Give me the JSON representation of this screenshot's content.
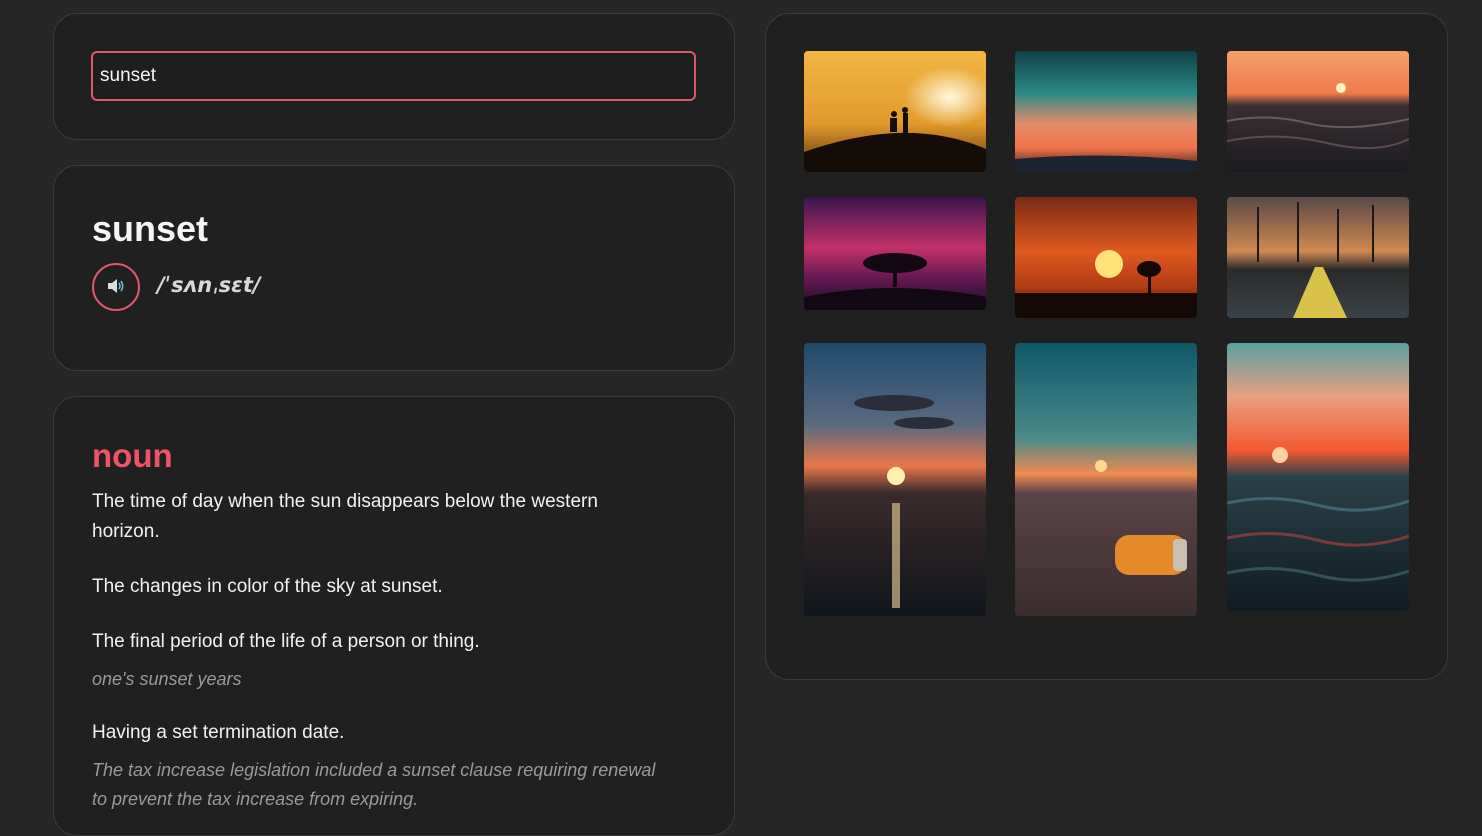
{
  "search": {
    "value": "sunset"
  },
  "entry": {
    "word": "sunset",
    "phonetic": "/ˈsʌnˌsɛt/",
    "audio_icon": "speaker-icon"
  },
  "meaning": {
    "part_of_speech": "noun",
    "definitions": [
      {
        "text": "The time of day when the sun disappears below the western horizon.",
        "example": ""
      },
      {
        "text": "The changes in color of the sky at sunset.",
        "example": ""
      },
      {
        "text": "The final period of the life of a person or thing.",
        "example": "one's sunset years"
      },
      {
        "text": "Having a set termination date.",
        "example": "The tax increase legislation included a sunset clause requiring renewal to prevent the tax increase from expiring."
      }
    ]
  },
  "colors": {
    "accent": "#e0576a",
    "part_of_speech": "#ef5368",
    "background": "#262626",
    "card": "#202020"
  }
}
